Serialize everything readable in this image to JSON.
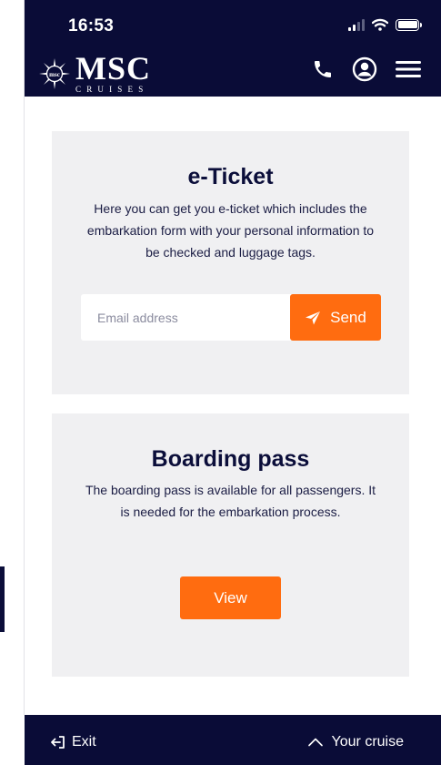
{
  "status_bar": {
    "time": "16:53",
    "icons": [
      "cellular-signal-icon",
      "wifi-icon",
      "battery-icon"
    ]
  },
  "header": {
    "logo_word": "MSC",
    "logo_sub": "CRUISES",
    "icons": [
      "phone-icon",
      "account-icon",
      "menu-icon"
    ]
  },
  "eticket": {
    "title": "e-Ticket",
    "description": "Here you can get you e-ticket which includes the embarkation form with your personal information to be checked and luggage tags.",
    "email_placeholder": "Email address",
    "email_value": "",
    "send_label": "Send",
    "send_icon": "paper-plane-icon"
  },
  "boarding": {
    "title": "Boarding pass",
    "description": "The boarding pass is available for all passengers. It is needed for the embarkation process.",
    "view_label": "View"
  },
  "footer": {
    "exit_label": "Exit",
    "exit_icon": "exit-icon",
    "cruise_label": "Your cruise",
    "cruise_icon": "chevron-up-icon"
  },
  "colors": {
    "navy": "#0a0c37",
    "accent": "#ff6c10",
    "card_bg": "#f0f0f2"
  }
}
